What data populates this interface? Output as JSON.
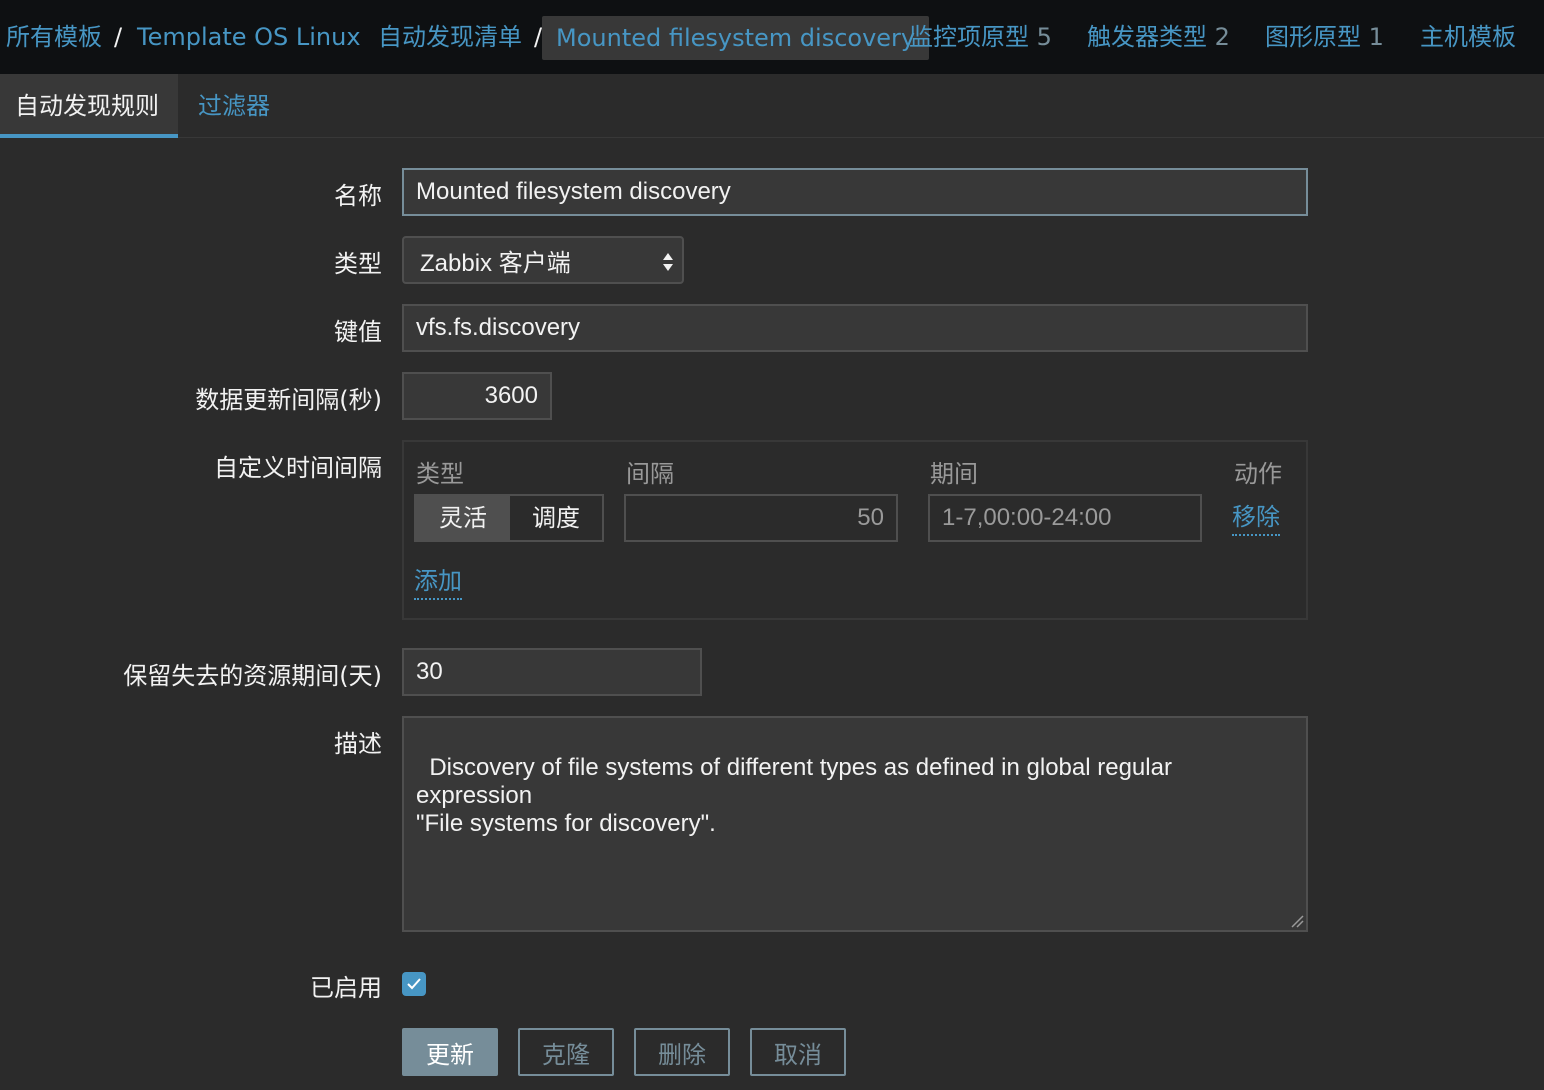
{
  "breadcrumbs": {
    "all_templates": "所有模板",
    "sep1": "/",
    "template": "Template OS Linux",
    "discovery_list": "自动发现清单",
    "sep2": "/",
    "current_rule": "Mounted filesystem discovery",
    "item_prototypes": "监控项原型",
    "item_prototypes_count": "5",
    "trigger_prototypes": "触发器类型",
    "trigger_prototypes_count": "2",
    "graph_prototypes": "图形原型",
    "graph_prototypes_count": "1",
    "host_prototypes": "主机模板"
  },
  "tabs": {
    "discovery_rule": "自动发现规则",
    "filters": "过滤器"
  },
  "form": {
    "name_label": "名称",
    "name_value": "Mounted filesystem discovery",
    "type_label": "类型",
    "type_value": "Zabbix 客户端",
    "key_label": "键值",
    "key_value": "vfs.fs.discovery",
    "update_interval_label": "数据更新间隔(秒)",
    "update_interval_value": "3600",
    "custom_intervals_label": "自定义时间间隔",
    "custom_intervals": {
      "col_type": "类型",
      "col_interval": "间隔",
      "col_period": "期间",
      "col_action": "动作",
      "type_flexible": "灵活",
      "type_scheduling": "调度",
      "interval_value": "50",
      "period_value": "1-7,00:00-24:00",
      "remove_link": "移除",
      "add_link": "添加"
    },
    "keep_lost_label": "保留失去的资源期间(天)",
    "keep_lost_value": "30",
    "description_label": "描述",
    "description_value": "Discovery of file systems of different types as defined in global regular expression\n\"File systems for discovery\".",
    "enabled_label": "已启用",
    "enabled": true
  },
  "buttons": {
    "update": "更新",
    "clone": "克隆",
    "delete": "删除",
    "cancel": "取消"
  },
  "colors": {
    "accent": "#4796c4",
    "header_bg": "#0e1012",
    "body_bg": "#2b2b2b",
    "button_primary": "#768d99"
  }
}
